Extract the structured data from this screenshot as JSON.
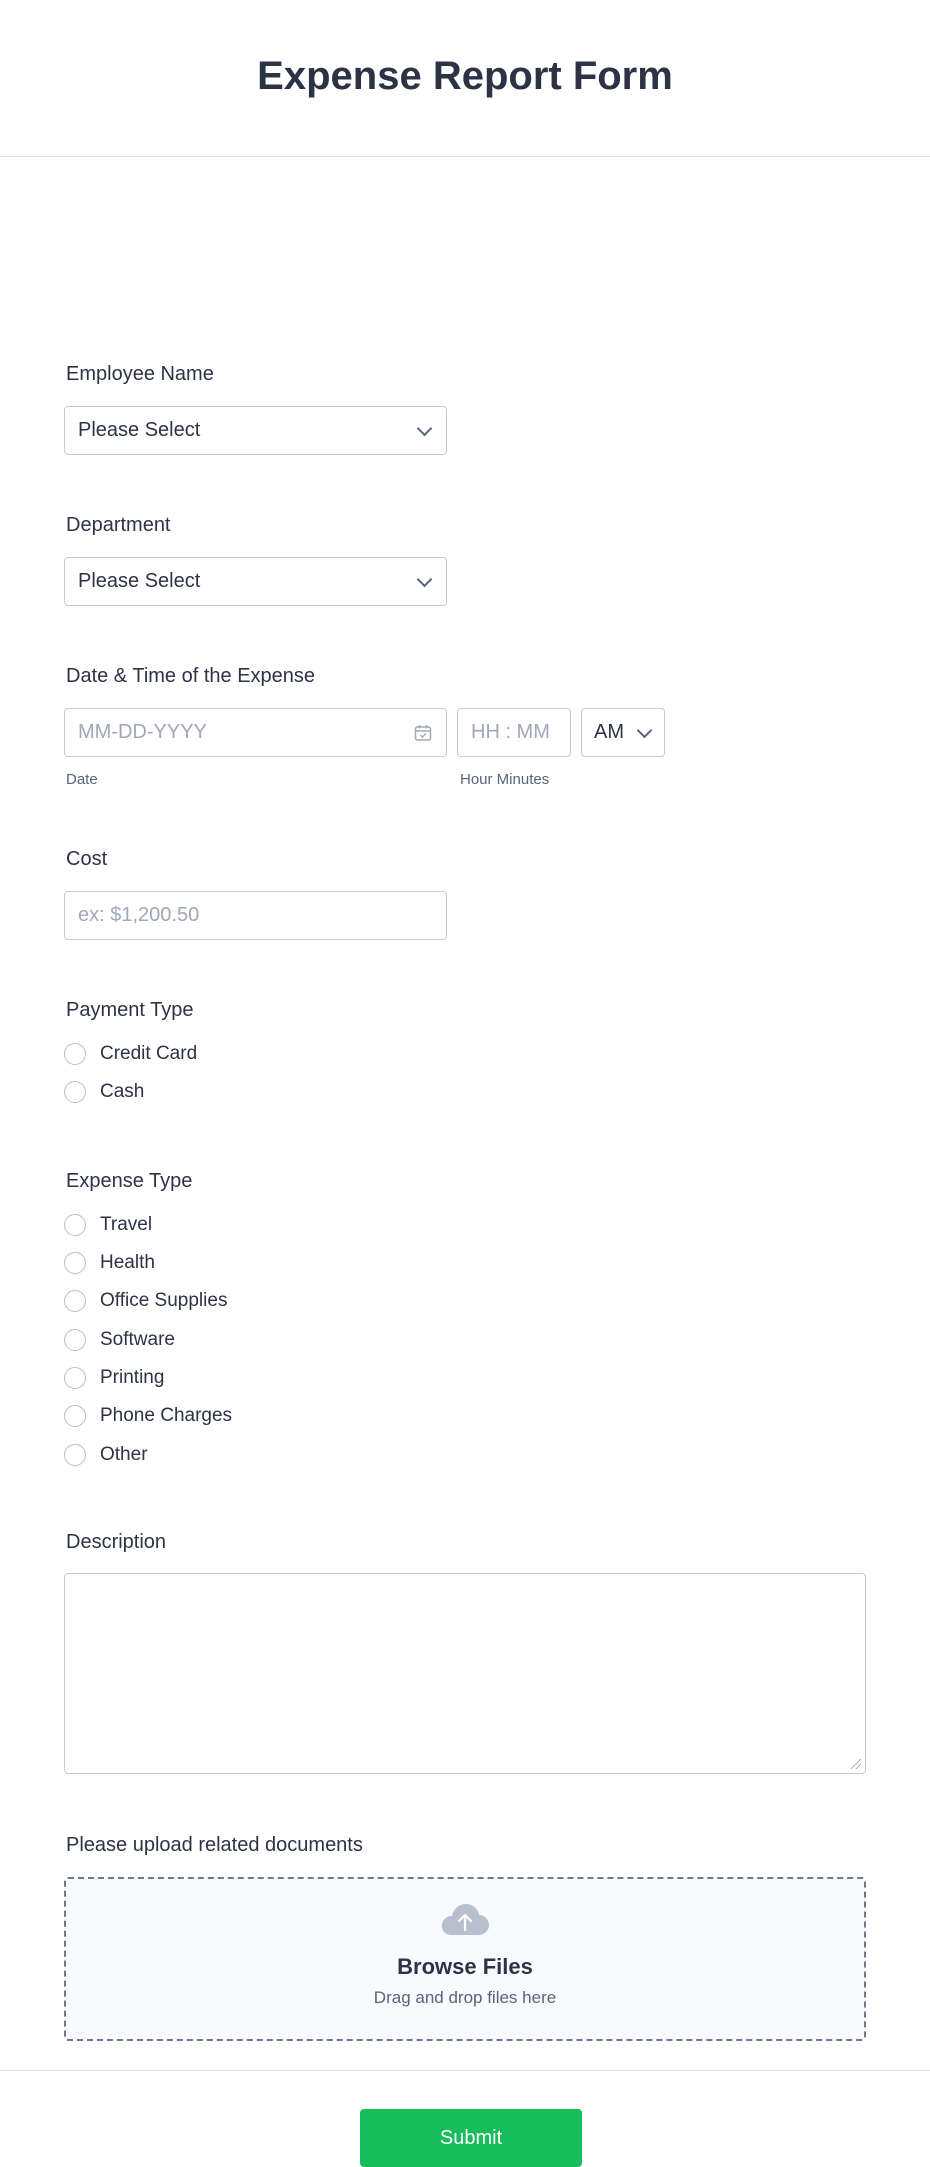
{
  "form": {
    "title": "Expense Report Form"
  },
  "employee": {
    "label": "Employee Name",
    "selected": "Please Select"
  },
  "department": {
    "label": "Department",
    "selected": "Please Select"
  },
  "datetime": {
    "label": "Date & Time of the Expense",
    "date_placeholder": "MM-DD-YYYY",
    "date_sublabel": "Date",
    "time_placeholder": "HH : MM",
    "time_sublabel": "Hour Minutes",
    "ampm": "AM"
  },
  "cost": {
    "label": "Cost",
    "placeholder": "ex: $1,200.50"
  },
  "payment": {
    "label": "Payment Type",
    "options": [
      "Credit Card",
      "Cash"
    ]
  },
  "expense_type": {
    "label": "Expense Type",
    "options": [
      "Travel",
      "Health",
      "Office Supplies",
      "Software",
      "Printing",
      "Phone Charges",
      "Other"
    ]
  },
  "description": {
    "label": "Description"
  },
  "upload": {
    "label": "Please upload related documents",
    "browse": "Browse Files",
    "hint": "Drag and drop files here"
  },
  "submit": {
    "label": "Submit"
  },
  "colors": {
    "accent": "#18bd5b",
    "text": "#2c3345",
    "border": "#c3cad8"
  },
  "icons": {
    "select": "chevron-down-icon",
    "date": "calendar-icon",
    "upload": "cloud-upload-icon"
  }
}
